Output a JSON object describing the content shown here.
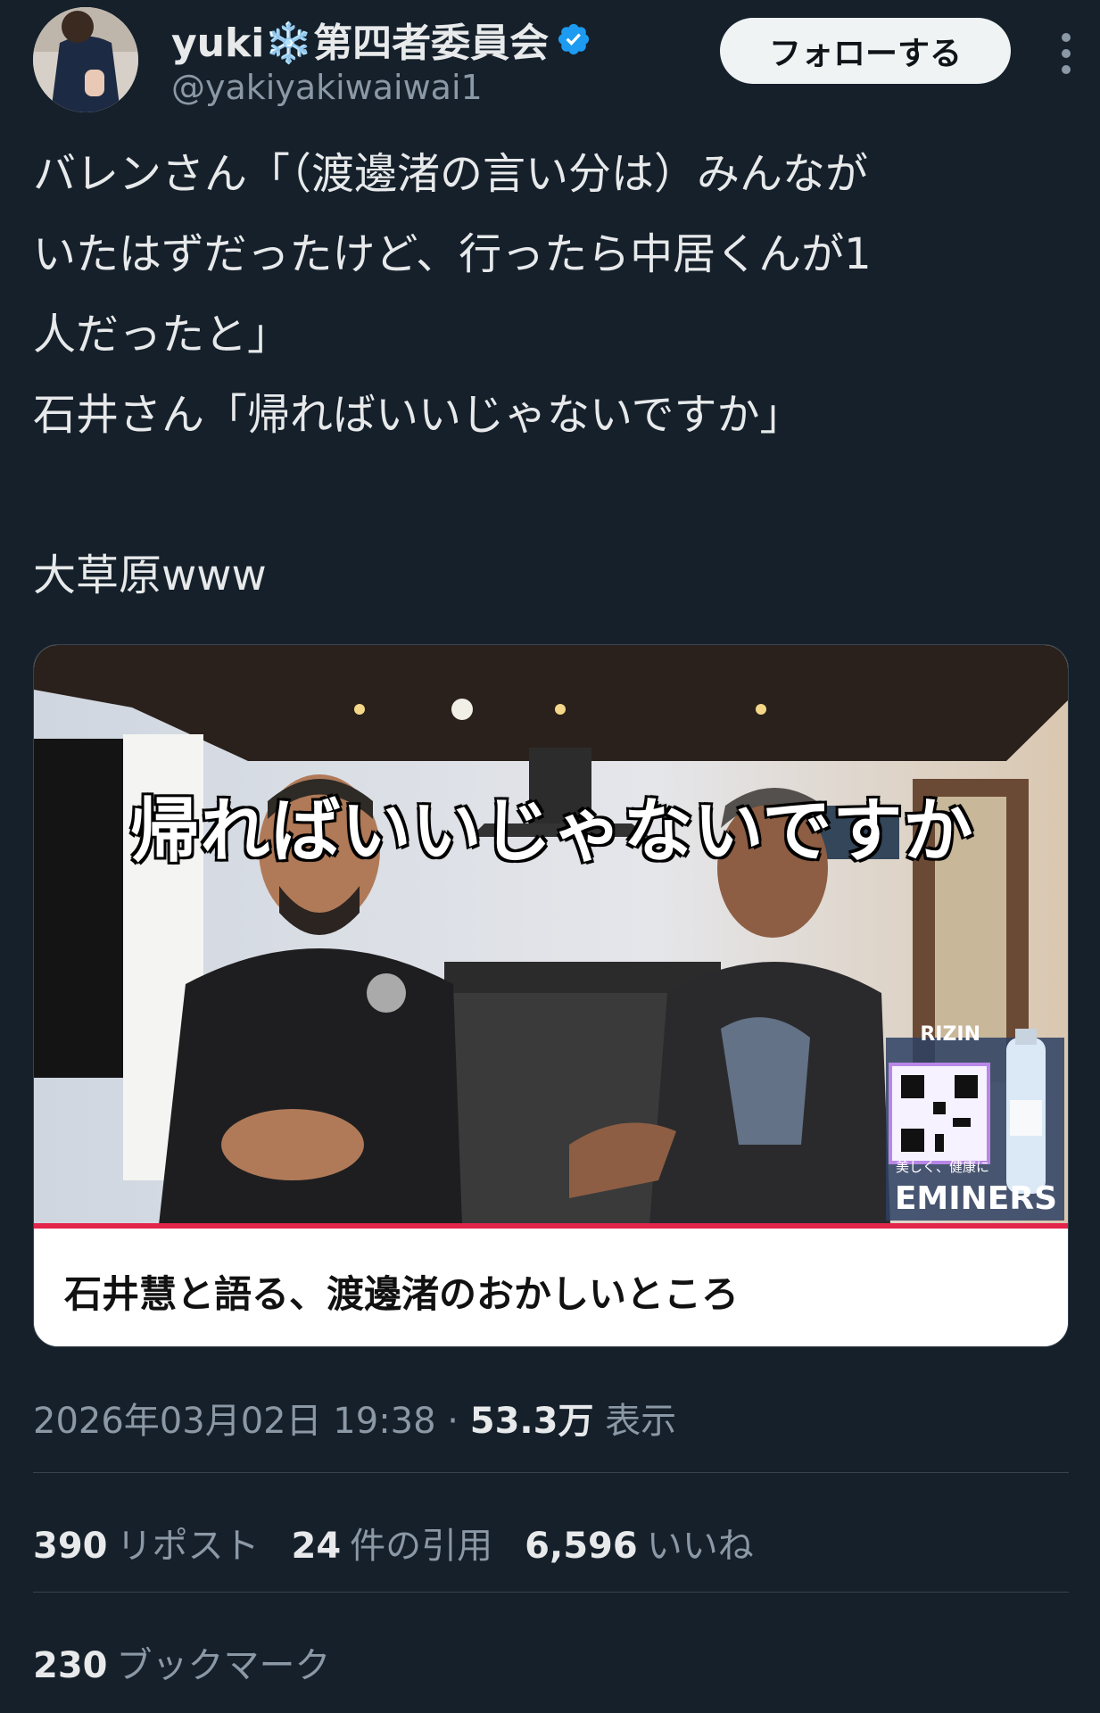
{
  "author": {
    "display_name": "yuki❄️第四者委員会",
    "handle": "@yakiyakiwaiwai1",
    "verified": true
  },
  "follow_button": {
    "label": "フォローする"
  },
  "tweet": {
    "text": "バレンさん「（渡邊渚の言い分は）みんなが\nいたはずだったけど、行ったら中居くんが1\n人だったと」\n石井さん「帰ればいいじゃないですか」\n\n大草原www"
  },
  "media": {
    "caption": "帰ればいいじゃないですか",
    "ad_top": "RIZIN",
    "ad_tag": "美しく、健康に",
    "ad_brand": "EMINERS",
    "title": "石井慧と語る、渡邊渚のおかしいところ"
  },
  "meta": {
    "timestamp": "2026年03月02日 19:38",
    "separator": " · ",
    "views_count": "53.3万",
    "views_label": "表示"
  },
  "stats": {
    "reposts_count": "390",
    "reposts_label": "リポスト",
    "quotes_count": "24",
    "quotes_label": "件の引用",
    "likes_count": "6,596",
    "likes_label": "いいね",
    "bookmarks_count": "230",
    "bookmarks_label": "ブックマーク"
  },
  "colors": {
    "background": "#15202b",
    "verified": "#1d9bf0",
    "muted_text": "#8b98a5",
    "progress": "#e3254c"
  }
}
